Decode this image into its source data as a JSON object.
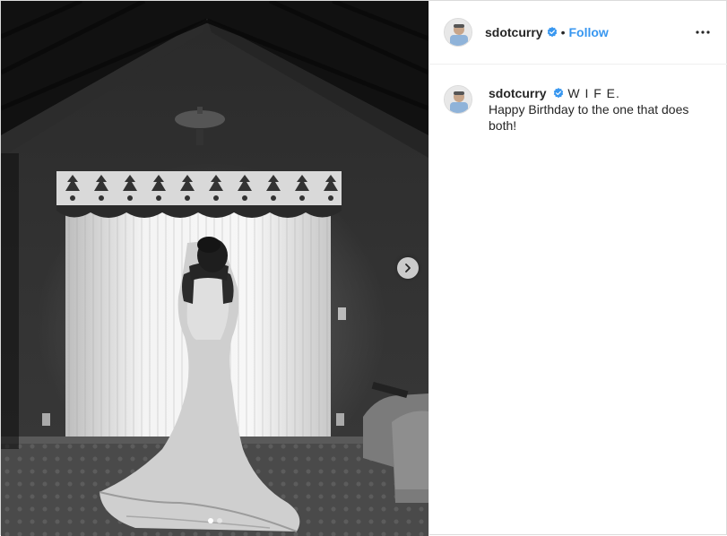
{
  "post": {
    "username": "sdotcurry",
    "follow_label": "Follow",
    "bullet": "•",
    "more_icon": "more-horizontal-icon",
    "verified_color": "#3897f0",
    "link_color": "#3897f0"
  },
  "caption": {
    "username": "sdotcurry",
    "title": "W I F E.",
    "text": "Happy Birthday to the one that does both!"
  },
  "carousel": {
    "slide_count": 2,
    "active_index": 0,
    "next_icon": "chevron-right-icon"
  }
}
